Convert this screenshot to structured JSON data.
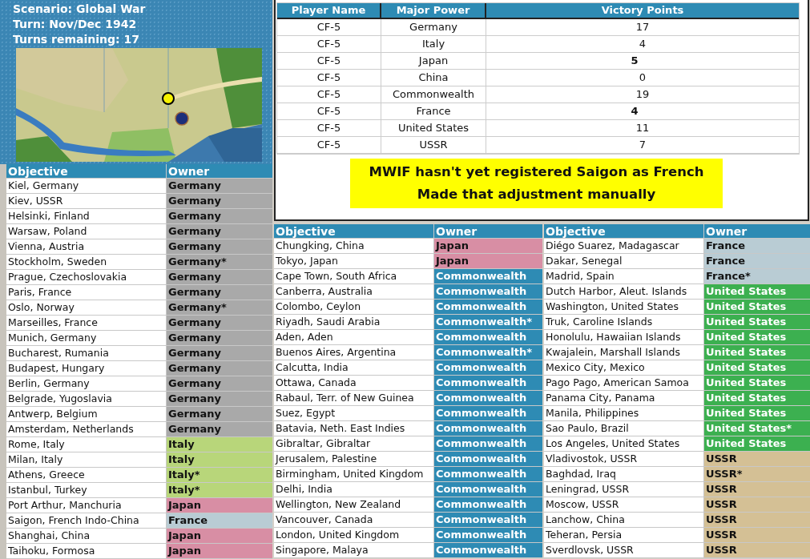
{
  "header": {
    "scenario": "Scenario: Global War",
    "turn": "Turn: Nov/Dec 1942",
    "turns_remaining": "Turns remaining: 17"
  },
  "victory_table": {
    "columns": [
      "Player Name",
      "Major Power",
      "Victory Points"
    ],
    "rows": [
      {
        "player": "CF-5",
        "power": "Germany",
        "points": "17",
        "edited": false
      },
      {
        "player": "CF-5",
        "power": "Italy",
        "points": "4",
        "edited": false
      },
      {
        "player": "CF-5",
        "power": "Japan",
        "points": "5",
        "edited": true
      },
      {
        "player": "CF-5",
        "power": "China",
        "points": "0",
        "edited": false
      },
      {
        "player": "CF-5",
        "power": "Commonwealth",
        "points": "19",
        "edited": false
      },
      {
        "player": "CF-5",
        "power": "France",
        "points": "4",
        "edited": true
      },
      {
        "player": "CF-5",
        "power": "United States",
        "points": "11",
        "edited": false
      },
      {
        "player": "CF-5",
        "power": "USSR",
        "points": "7",
        "edited": false
      }
    ]
  },
  "note": {
    "lines": [
      "MWIF hasn't yet registered Saigon as French",
      "Made that adjustment manually"
    ]
  },
  "objective_tables": [
    {
      "columns": [
        "Objective",
        "Owner"
      ],
      "rows": [
        {
          "objective": "Kiel, Germany",
          "owner": "Germany",
          "color": "#a9a9a9"
        },
        {
          "objective": "Kiev, USSR",
          "owner": "Germany",
          "color": "#a9a9a9"
        },
        {
          "objective": "Helsinki, Finland",
          "owner": "Germany",
          "color": "#a9a9a9"
        },
        {
          "objective": "Warsaw, Poland",
          "owner": "Germany",
          "color": "#a9a9a9"
        },
        {
          "objective": "Vienna, Austria",
          "owner": "Germany",
          "color": "#a9a9a9"
        },
        {
          "objective": "Stockholm, Sweden",
          "owner": "Germany*",
          "color": "#a9a9a9"
        },
        {
          "objective": "Prague, Czechoslovakia",
          "owner": "Germany",
          "color": "#a9a9a9"
        },
        {
          "objective": "Paris, France",
          "owner": "Germany",
          "color": "#a9a9a9"
        },
        {
          "objective": "Oslo, Norway",
          "owner": "Germany*",
          "color": "#a9a9a9"
        },
        {
          "objective": "Marseilles, France",
          "owner": "Germany",
          "color": "#a9a9a9"
        },
        {
          "objective": "Munich, Germany",
          "owner": "Germany",
          "color": "#a9a9a9"
        },
        {
          "objective": "Bucharest, Rumania",
          "owner": "Germany",
          "color": "#a9a9a9"
        },
        {
          "objective": "Budapest, Hungary",
          "owner": "Germany",
          "color": "#a9a9a9"
        },
        {
          "objective": "Berlin, Germany",
          "owner": "Germany",
          "color": "#a9a9a9"
        },
        {
          "objective": "Belgrade, Yugoslavia",
          "owner": "Germany",
          "color": "#a9a9a9"
        },
        {
          "objective": "Antwerp, Belgium",
          "owner": "Germany",
          "color": "#a9a9a9"
        },
        {
          "objective": "Amsterdam, Netherlands",
          "owner": "Germany",
          "color": "#a9a9a9"
        },
        {
          "objective": "Rome, Italy",
          "owner": "Italy",
          "color": "#b8d67a"
        },
        {
          "objective": "Milan, Italy",
          "owner": "Italy",
          "color": "#b8d67a"
        },
        {
          "objective": "Athens, Greece",
          "owner": "Italy*",
          "color": "#b8d67a"
        },
        {
          "objective": "Istanbul, Turkey",
          "owner": "Italy*",
          "color": "#b8d67a"
        },
        {
          "objective": "Port Arthur, Manchuria",
          "owner": "Japan",
          "color": "#d88ea4"
        },
        {
          "objective": "Saigon, French Indo-China",
          "owner": "France",
          "color": "#b9ccd4"
        },
        {
          "objective": "Shanghai, China",
          "owner": "Japan",
          "color": "#d88ea4"
        },
        {
          "objective": "Taihoku, Formosa",
          "owner": "Japan",
          "color": "#d88ea4"
        }
      ]
    },
    {
      "columns": [
        "Objective",
        "Owner"
      ],
      "rows": [
        {
          "objective": "Chungking, China",
          "owner": "Japan",
          "color": "#d88ea4"
        },
        {
          "objective": "Tokyo, Japan",
          "owner": "Japan",
          "color": "#d88ea4"
        },
        {
          "objective": "Cape Town, South Africa",
          "owner": "Commonwealth",
          "color": "#2e8bb4"
        },
        {
          "objective": "Canberra, Australia",
          "owner": "Commonwealth",
          "color": "#2e8bb4"
        },
        {
          "objective": "Colombo, Ceylon",
          "owner": "Commonwealth",
          "color": "#2e8bb4"
        },
        {
          "objective": "Riyadh, Saudi Arabia",
          "owner": "Commonwealth*",
          "color": "#2e8bb4"
        },
        {
          "objective": "Aden, Aden",
          "owner": "Commonwealth",
          "color": "#2e8bb4"
        },
        {
          "objective": "Buenos Aires, Argentina",
          "owner": "Commonwealth*",
          "color": "#2e8bb4"
        },
        {
          "objective": "Calcutta, India",
          "owner": "Commonwealth",
          "color": "#2e8bb4"
        },
        {
          "objective": "Ottawa, Canada",
          "owner": "Commonwealth",
          "color": "#2e8bb4"
        },
        {
          "objective": "Rabaul, Terr. of New Guinea",
          "owner": "Commonwealth",
          "color": "#2e8bb4"
        },
        {
          "objective": "Suez, Egypt",
          "owner": "Commonwealth",
          "color": "#2e8bb4"
        },
        {
          "objective": "Batavia, Neth. East Indies",
          "owner": "Commonwealth",
          "color": "#2e8bb4"
        },
        {
          "objective": "Gibraltar, Gibraltar",
          "owner": "Commonwealth",
          "color": "#2e8bb4"
        },
        {
          "objective": "Jerusalem, Palestine",
          "owner": "Commonwealth",
          "color": "#2e8bb4"
        },
        {
          "objective": "Birmingham, United Kingdom",
          "owner": "Commonwealth",
          "color": "#2e8bb4"
        },
        {
          "objective": "Delhi, India",
          "owner": "Commonwealth",
          "color": "#2e8bb4"
        },
        {
          "objective": "Wellington, New Zealand",
          "owner": "Commonwealth",
          "color": "#2e8bb4"
        },
        {
          "objective": "Vancouver, Canada",
          "owner": "Commonwealth",
          "color": "#2e8bb4"
        },
        {
          "objective": "London, United Kingdom",
          "owner": "Commonwealth",
          "color": "#2e8bb4"
        },
        {
          "objective": "Singapore, Malaya",
          "owner": "Commonwealth",
          "color": "#2e8bb4"
        }
      ]
    },
    {
      "columns": [
        "Objective",
        "Owner"
      ],
      "rows": [
        {
          "objective": "Diégo Suarez, Madagascar",
          "owner": "France",
          "color": "#b9ccd4"
        },
        {
          "objective": "Dakar, Senegal",
          "owner": "France",
          "color": "#b9ccd4"
        },
        {
          "objective": "Madrid, Spain",
          "owner": "France*",
          "color": "#b9ccd4"
        },
        {
          "objective": "Dutch Harbor, Aleut. Islands",
          "owner": "United States",
          "color": "#3cb050"
        },
        {
          "objective": "Washington, United States",
          "owner": "United States",
          "color": "#3cb050"
        },
        {
          "objective": "Truk, Caroline Islands",
          "owner": "United States",
          "color": "#3cb050"
        },
        {
          "objective": "Honolulu, Hawaiian Islands",
          "owner": "United States",
          "color": "#3cb050"
        },
        {
          "objective": "Kwajalein, Marshall Islands",
          "owner": "United States",
          "color": "#3cb050"
        },
        {
          "objective": "Mexico City, Mexico",
          "owner": "United States",
          "color": "#3cb050"
        },
        {
          "objective": "Pago Pago, American Samoa",
          "owner": "United States",
          "color": "#3cb050"
        },
        {
          "objective": "Panama City, Panama",
          "owner": "United States",
          "color": "#3cb050"
        },
        {
          "objective": "Manila, Philippines",
          "owner": "United States",
          "color": "#3cb050"
        },
        {
          "objective": "Sao Paulo, Brazil",
          "owner": "United States*",
          "color": "#3cb050"
        },
        {
          "objective": "Los Angeles, United States",
          "owner": "United States",
          "color": "#3cb050"
        },
        {
          "objective": "Vladivostok, USSR",
          "owner": "USSR",
          "color": "#d4c095"
        },
        {
          "objective": "Baghdad, Iraq",
          "owner": "USSR*",
          "color": "#d4c095"
        },
        {
          "objective": "Leningrad, USSR",
          "owner": "USSR",
          "color": "#d4c095"
        },
        {
          "objective": "Moscow, USSR",
          "owner": "USSR",
          "color": "#d4c095"
        },
        {
          "objective": "Lanchow, China",
          "owner": "USSR",
          "color": "#d4c095"
        },
        {
          "objective": "Teheran, Persia",
          "owner": "USSR",
          "color": "#d4c095"
        },
        {
          "objective": "Sverdlovsk, USSR",
          "owner": "USSR",
          "color": "#d4c095"
        }
      ]
    }
  ]
}
